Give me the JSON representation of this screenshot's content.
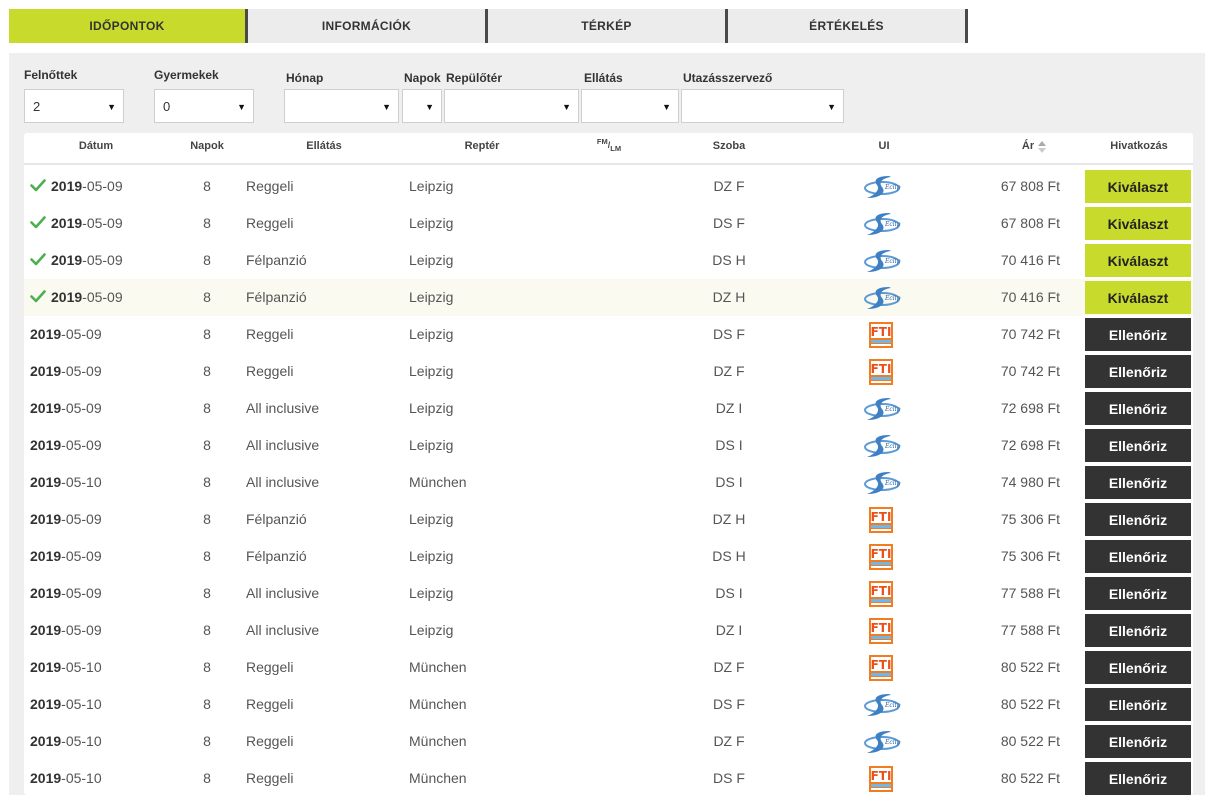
{
  "tabs": [
    {
      "label": "IDŐPONTOK"
    },
    {
      "label": "INFORMÁCIÓK"
    },
    {
      "label": "TÉRKÉP"
    },
    {
      "label": "ÉRTÉKELÉS"
    }
  ],
  "filters": {
    "felnottek": {
      "label": "Felnőttek",
      "value": "2"
    },
    "gyermekek": {
      "label": "Gyermekek",
      "value": "0"
    },
    "honap": {
      "label": "Hónap",
      "value": ""
    },
    "napok": {
      "label": "Napok",
      "value": ""
    },
    "repuloter": {
      "label": "Repülőtér",
      "value": ""
    },
    "ellatas": {
      "label": "Ellátás",
      "value": ""
    },
    "utazasszervezo": {
      "label": "Utazásszervező",
      "value": ""
    }
  },
  "columns": {
    "datum": "Dátum",
    "napok": "Napok",
    "ellatas": "Ellátás",
    "repter": "Reptér",
    "fm": "FM",
    "lm": "LM",
    "szoba": "Szoba",
    "ui": "UI",
    "ar": "Ár",
    "hivatkozas": "Hivatkozás"
  },
  "colors": {
    "accent": "#c8da2b",
    "dark_button": "#333333",
    "check": "#4caf50"
  },
  "rows": [
    {
      "checked": true,
      "year": "2019",
      "rest": "-05-09",
      "napok": "8",
      "ellatas": "Reggeli",
      "repter": "Leipzig",
      "szoba": "DZ F",
      "ui_icon": "eclipse-logo-icon",
      "ar": "67 808 Ft",
      "button": "Kiválaszt",
      "style": "green"
    },
    {
      "checked": true,
      "year": "2019",
      "rest": "-05-09",
      "napok": "8",
      "ellatas": "Reggeli",
      "repter": "Leipzig",
      "szoba": "DS F",
      "ui_icon": "eclipse-logo-icon",
      "ar": "67 808 Ft",
      "button": "Kiválaszt",
      "style": "green"
    },
    {
      "checked": true,
      "year": "2019",
      "rest": "-05-09",
      "napok": "8",
      "ellatas": "Félpanzió",
      "repter": "Leipzig",
      "szoba": "DS H",
      "ui_icon": "eclipse-logo-icon",
      "ar": "70 416 Ft",
      "button": "Kiválaszt",
      "style": "green"
    },
    {
      "checked": true,
      "year": "2019",
      "rest": "-05-09",
      "napok": "8",
      "ellatas": "Félpanzió",
      "repter": "Leipzig",
      "szoba": "DZ H",
      "ui_icon": "eclipse-logo-icon",
      "ar": "70 416 Ft",
      "button": "Kiválaszt",
      "style": "green",
      "highlight": true
    },
    {
      "checked": false,
      "year": "2019",
      "rest": "-05-09",
      "napok": "8",
      "ellatas": "Reggeli",
      "repter": "Leipzig",
      "szoba": "DS F",
      "ui_icon": "fti-logo-icon",
      "ar": "70 742 Ft",
      "button": "Ellenőriz",
      "style": "dark"
    },
    {
      "checked": false,
      "year": "2019",
      "rest": "-05-09",
      "napok": "8",
      "ellatas": "Reggeli",
      "repter": "Leipzig",
      "szoba": "DZ F",
      "ui_icon": "fti-logo-icon",
      "ar": "70 742 Ft",
      "button": "Ellenőriz",
      "style": "dark"
    },
    {
      "checked": false,
      "year": "2019",
      "rest": "-05-09",
      "napok": "8",
      "ellatas": "All inclusive",
      "repter": "Leipzig",
      "szoba": "DZ I",
      "ui_icon": "eclipse-logo-icon",
      "ar": "72 698 Ft",
      "button": "Ellenőriz",
      "style": "dark"
    },
    {
      "checked": false,
      "year": "2019",
      "rest": "-05-09",
      "napok": "8",
      "ellatas": "All inclusive",
      "repter": "Leipzig",
      "szoba": "DS I",
      "ui_icon": "eclipse-logo-icon",
      "ar": "72 698 Ft",
      "button": "Ellenőriz",
      "style": "dark"
    },
    {
      "checked": false,
      "year": "2019",
      "rest": "-05-10",
      "napok": "8",
      "ellatas": "All inclusive",
      "repter": "München",
      "szoba": "DS I",
      "ui_icon": "eclipse-logo-icon",
      "ar": "74 980 Ft",
      "button": "Ellenőriz",
      "style": "dark"
    },
    {
      "checked": false,
      "year": "2019",
      "rest": "-05-09",
      "napok": "8",
      "ellatas": "Félpanzió",
      "repter": "Leipzig",
      "szoba": "DZ H",
      "ui_icon": "fti-logo-icon",
      "ar": "75 306 Ft",
      "button": "Ellenőriz",
      "style": "dark"
    },
    {
      "checked": false,
      "year": "2019",
      "rest": "-05-09",
      "napok": "8",
      "ellatas": "Félpanzió",
      "repter": "Leipzig",
      "szoba": "DS H",
      "ui_icon": "fti-logo-icon",
      "ar": "75 306 Ft",
      "button": "Ellenőriz",
      "style": "dark"
    },
    {
      "checked": false,
      "year": "2019",
      "rest": "-05-09",
      "napok": "8",
      "ellatas": "All inclusive",
      "repter": "Leipzig",
      "szoba": "DS I",
      "ui_icon": "fti-logo-icon",
      "ar": "77 588 Ft",
      "button": "Ellenőriz",
      "style": "dark"
    },
    {
      "checked": false,
      "year": "2019",
      "rest": "-05-09",
      "napok": "8",
      "ellatas": "All inclusive",
      "repter": "Leipzig",
      "szoba": "DZ I",
      "ui_icon": "fti-logo-icon",
      "ar": "77 588 Ft",
      "button": "Ellenőriz",
      "style": "dark"
    },
    {
      "checked": false,
      "year": "2019",
      "rest": "-05-10",
      "napok": "8",
      "ellatas": "Reggeli",
      "repter": "München",
      "szoba": "DZ F",
      "ui_icon": "fti-logo-icon",
      "ar": "80 522 Ft",
      "button": "Ellenőriz",
      "style": "dark"
    },
    {
      "checked": false,
      "year": "2019",
      "rest": "-05-10",
      "napok": "8",
      "ellatas": "Reggeli",
      "repter": "München",
      "szoba": "DS F",
      "ui_icon": "eclipse-logo-icon",
      "ar": "80 522 Ft",
      "button": "Ellenőriz",
      "style": "dark"
    },
    {
      "checked": false,
      "year": "2019",
      "rest": "-05-10",
      "napok": "8",
      "ellatas": "Reggeli",
      "repter": "München",
      "szoba": "DZ F",
      "ui_icon": "eclipse-logo-icon",
      "ar": "80 522 Ft",
      "button": "Ellenőriz",
      "style": "dark"
    },
    {
      "checked": false,
      "year": "2019",
      "rest": "-05-10",
      "napok": "8",
      "ellatas": "Reggeli",
      "repter": "München",
      "szoba": "DS F",
      "ui_icon": "fti-logo-icon",
      "ar": "80 522 Ft",
      "button": "Ellenőriz",
      "style": "dark"
    }
  ]
}
